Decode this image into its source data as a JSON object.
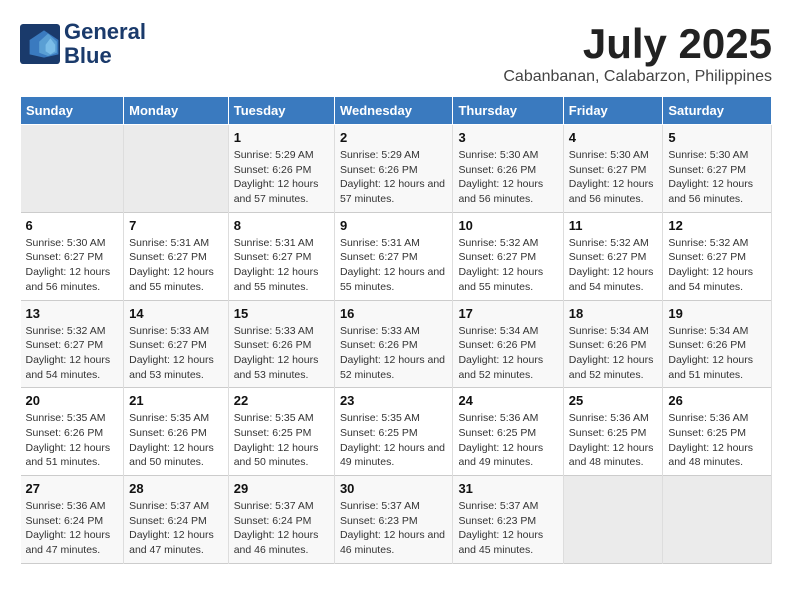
{
  "header": {
    "logo_line1": "General",
    "logo_line2": "Blue",
    "month": "July 2025",
    "location": "Cabanbanan, Calabarzon, Philippines"
  },
  "weekdays": [
    "Sunday",
    "Monday",
    "Tuesday",
    "Wednesday",
    "Thursday",
    "Friday",
    "Saturday"
  ],
  "weeks": [
    [
      {
        "day": "",
        "sunrise": "",
        "sunset": "",
        "daylight": ""
      },
      {
        "day": "",
        "sunrise": "",
        "sunset": "",
        "daylight": ""
      },
      {
        "day": "1",
        "sunrise": "Sunrise: 5:29 AM",
        "sunset": "Sunset: 6:26 PM",
        "daylight": "Daylight: 12 hours and 57 minutes."
      },
      {
        "day": "2",
        "sunrise": "Sunrise: 5:29 AM",
        "sunset": "Sunset: 6:26 PM",
        "daylight": "Daylight: 12 hours and 57 minutes."
      },
      {
        "day": "3",
        "sunrise": "Sunrise: 5:30 AM",
        "sunset": "Sunset: 6:26 PM",
        "daylight": "Daylight: 12 hours and 56 minutes."
      },
      {
        "day": "4",
        "sunrise": "Sunrise: 5:30 AM",
        "sunset": "Sunset: 6:27 PM",
        "daylight": "Daylight: 12 hours and 56 minutes."
      },
      {
        "day": "5",
        "sunrise": "Sunrise: 5:30 AM",
        "sunset": "Sunset: 6:27 PM",
        "daylight": "Daylight: 12 hours and 56 minutes."
      }
    ],
    [
      {
        "day": "6",
        "sunrise": "Sunrise: 5:30 AM",
        "sunset": "Sunset: 6:27 PM",
        "daylight": "Daylight: 12 hours and 56 minutes."
      },
      {
        "day": "7",
        "sunrise": "Sunrise: 5:31 AM",
        "sunset": "Sunset: 6:27 PM",
        "daylight": "Daylight: 12 hours and 55 minutes."
      },
      {
        "day": "8",
        "sunrise": "Sunrise: 5:31 AM",
        "sunset": "Sunset: 6:27 PM",
        "daylight": "Daylight: 12 hours and 55 minutes."
      },
      {
        "day": "9",
        "sunrise": "Sunrise: 5:31 AM",
        "sunset": "Sunset: 6:27 PM",
        "daylight": "Daylight: 12 hours and 55 minutes."
      },
      {
        "day": "10",
        "sunrise": "Sunrise: 5:32 AM",
        "sunset": "Sunset: 6:27 PM",
        "daylight": "Daylight: 12 hours and 55 minutes."
      },
      {
        "day": "11",
        "sunrise": "Sunrise: 5:32 AM",
        "sunset": "Sunset: 6:27 PM",
        "daylight": "Daylight: 12 hours and 54 minutes."
      },
      {
        "day": "12",
        "sunrise": "Sunrise: 5:32 AM",
        "sunset": "Sunset: 6:27 PM",
        "daylight": "Daylight: 12 hours and 54 minutes."
      }
    ],
    [
      {
        "day": "13",
        "sunrise": "Sunrise: 5:32 AM",
        "sunset": "Sunset: 6:27 PM",
        "daylight": "Daylight: 12 hours and 54 minutes."
      },
      {
        "day": "14",
        "sunrise": "Sunrise: 5:33 AM",
        "sunset": "Sunset: 6:27 PM",
        "daylight": "Daylight: 12 hours and 53 minutes."
      },
      {
        "day": "15",
        "sunrise": "Sunrise: 5:33 AM",
        "sunset": "Sunset: 6:26 PM",
        "daylight": "Daylight: 12 hours and 53 minutes."
      },
      {
        "day": "16",
        "sunrise": "Sunrise: 5:33 AM",
        "sunset": "Sunset: 6:26 PM",
        "daylight": "Daylight: 12 hours and 52 minutes."
      },
      {
        "day": "17",
        "sunrise": "Sunrise: 5:34 AM",
        "sunset": "Sunset: 6:26 PM",
        "daylight": "Daylight: 12 hours and 52 minutes."
      },
      {
        "day": "18",
        "sunrise": "Sunrise: 5:34 AM",
        "sunset": "Sunset: 6:26 PM",
        "daylight": "Daylight: 12 hours and 52 minutes."
      },
      {
        "day": "19",
        "sunrise": "Sunrise: 5:34 AM",
        "sunset": "Sunset: 6:26 PM",
        "daylight": "Daylight: 12 hours and 51 minutes."
      }
    ],
    [
      {
        "day": "20",
        "sunrise": "Sunrise: 5:35 AM",
        "sunset": "Sunset: 6:26 PM",
        "daylight": "Daylight: 12 hours and 51 minutes."
      },
      {
        "day": "21",
        "sunrise": "Sunrise: 5:35 AM",
        "sunset": "Sunset: 6:26 PM",
        "daylight": "Daylight: 12 hours and 50 minutes."
      },
      {
        "day": "22",
        "sunrise": "Sunrise: 5:35 AM",
        "sunset": "Sunset: 6:25 PM",
        "daylight": "Daylight: 12 hours and 50 minutes."
      },
      {
        "day": "23",
        "sunrise": "Sunrise: 5:35 AM",
        "sunset": "Sunset: 6:25 PM",
        "daylight": "Daylight: 12 hours and 49 minutes."
      },
      {
        "day": "24",
        "sunrise": "Sunrise: 5:36 AM",
        "sunset": "Sunset: 6:25 PM",
        "daylight": "Daylight: 12 hours and 49 minutes."
      },
      {
        "day": "25",
        "sunrise": "Sunrise: 5:36 AM",
        "sunset": "Sunset: 6:25 PM",
        "daylight": "Daylight: 12 hours and 48 minutes."
      },
      {
        "day": "26",
        "sunrise": "Sunrise: 5:36 AM",
        "sunset": "Sunset: 6:25 PM",
        "daylight": "Daylight: 12 hours and 48 minutes."
      }
    ],
    [
      {
        "day": "27",
        "sunrise": "Sunrise: 5:36 AM",
        "sunset": "Sunset: 6:24 PM",
        "daylight": "Daylight: 12 hours and 47 minutes."
      },
      {
        "day": "28",
        "sunrise": "Sunrise: 5:37 AM",
        "sunset": "Sunset: 6:24 PM",
        "daylight": "Daylight: 12 hours and 47 minutes."
      },
      {
        "day": "29",
        "sunrise": "Sunrise: 5:37 AM",
        "sunset": "Sunset: 6:24 PM",
        "daylight": "Daylight: 12 hours and 46 minutes."
      },
      {
        "day": "30",
        "sunrise": "Sunrise: 5:37 AM",
        "sunset": "Sunset: 6:23 PM",
        "daylight": "Daylight: 12 hours and 46 minutes."
      },
      {
        "day": "31",
        "sunrise": "Sunrise: 5:37 AM",
        "sunset": "Sunset: 6:23 PM",
        "daylight": "Daylight: 12 hours and 45 minutes."
      },
      {
        "day": "",
        "sunrise": "",
        "sunset": "",
        "daylight": ""
      },
      {
        "day": "",
        "sunrise": "",
        "sunset": "",
        "daylight": ""
      }
    ]
  ]
}
